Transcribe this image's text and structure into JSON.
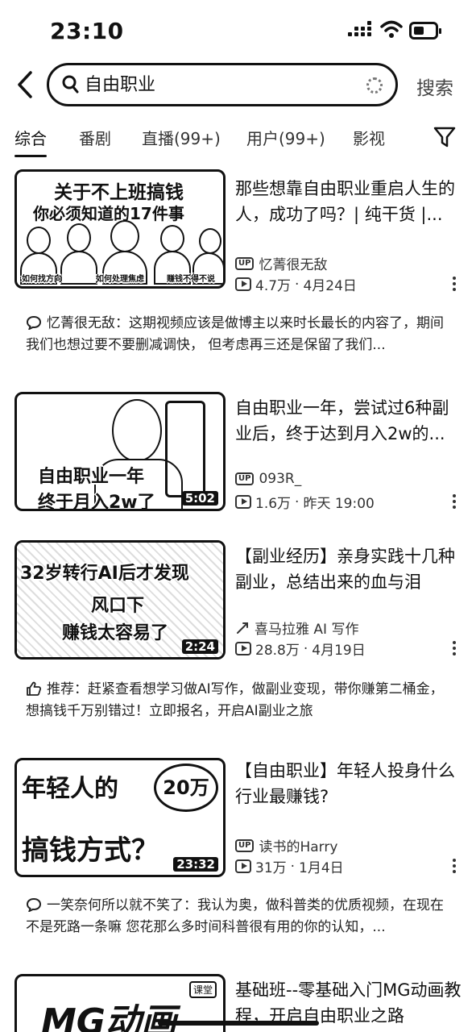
{
  "status_bar": {
    "time": "23:10"
  },
  "search": {
    "query": "自由职业",
    "button": "搜索"
  },
  "tabs": [
    "综合",
    "番剧",
    "直播(99+)",
    "用户(99+)",
    "影视"
  ],
  "results": [
    {
      "thumb_lines": [
        "关于不上班搞钱",
        "你必须知道的17件事"
      ],
      "thumb_captions": [
        "如何找方向",
        "如何处理焦虑",
        "赚钱不得不说"
      ],
      "title": "那些想靠自由职业重启人生的人，成功了吗？| 纯干货 |...",
      "author": "忆菁很无敌",
      "views": "4.7万",
      "date": "4月24日",
      "comment_prefix": "忆菁很无敌：",
      "comment": "这期视频应该是做博主以来时长最长的内容了，期间我们也想过要不要删减调快， 但考虑再三还是保留了我们..."
    },
    {
      "thumb_lines": [
        "自由职业一年",
        "终于月入2w了"
      ],
      "duration": "5:02",
      "title": "自由职业一年，尝试过6种副业后，终于达到月入2w的...",
      "author": "093R_",
      "views": "1.6万",
      "date": "昨天 19:00"
    },
    {
      "thumb_lines": [
        "32岁转行AI后才发现",
        "风口下",
        "赚钱太容易了"
      ],
      "duration": "2:24",
      "title": "【副业经历】亲身实践十几种副业，总结出来的血与泪",
      "author": "喜马拉雅 AI 写作",
      "views": "28.8万",
      "date": "4月19日",
      "comment_prefix": "推荐：",
      "comment": "赶紧查看想学习做AI写作，做副业变现，带你赚第二桶金，想搞钱千万别错过！立即报名，开启AI副业之旅"
    },
    {
      "thumb_lines": [
        "年轻人的",
        "20万",
        "搞钱方式？"
      ],
      "duration": "23:32",
      "title": "【自由职业】年轻人投身什么行业最赚钱?",
      "author": "读书的Harry",
      "views": "31万",
      "date": "1月4日",
      "comment_prefix": "一笑奈何所以就不笑了：",
      "comment": "我认为奥，做科普类的优质视频，在现在不是死路一条嘛 您花那么多时间科普很有用的你的认知，..."
    },
    {
      "thumb_lines": [
        "MG动画"
      ],
      "thumb_badge": "课堂",
      "title": "基础班--零基础入门MG动画教程，开启自由职业之路"
    }
  ]
}
